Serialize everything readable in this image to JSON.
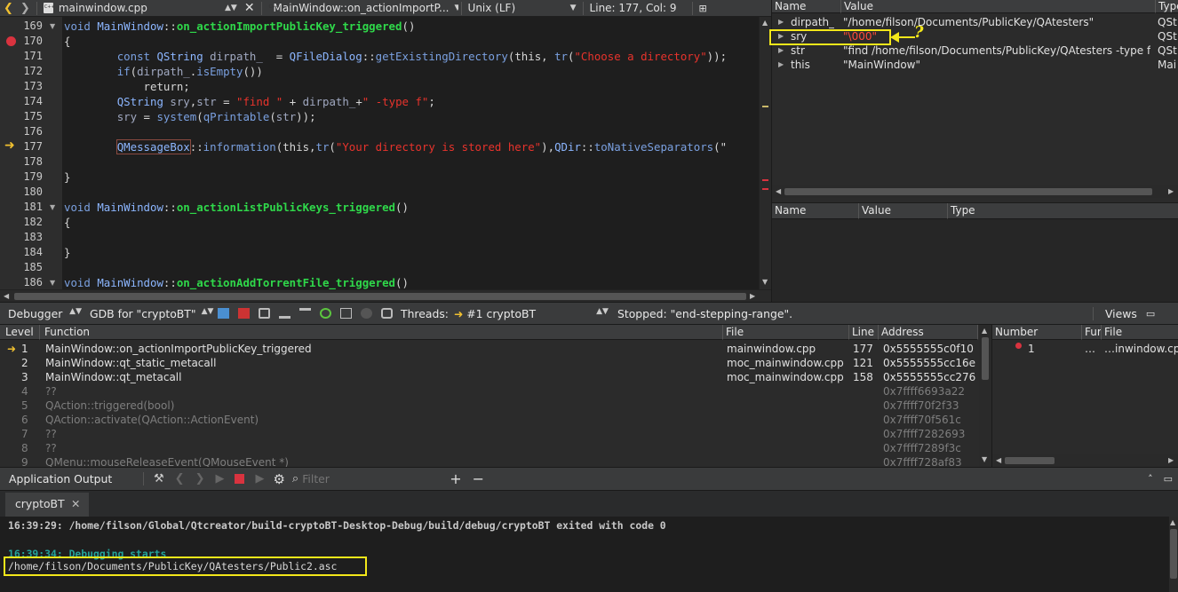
{
  "editor_toolbar": {
    "file_name": "mainwindow.cpp",
    "symbol": "MainWindow::on_actionImportP...",
    "line_ending": "Unix (LF)",
    "position": "Line: 177, Col: 9"
  },
  "code_lines": [
    {
      "n": "169",
      "fold": true
    },
    {
      "n": "170",
      "bp": true
    },
    {
      "n": "171"
    },
    {
      "n": "172"
    },
    {
      "n": "173"
    },
    {
      "n": "174"
    },
    {
      "n": "175"
    },
    {
      "n": "176"
    },
    {
      "n": "177",
      "current": true
    },
    {
      "n": "178"
    },
    {
      "n": "179"
    },
    {
      "n": "180"
    },
    {
      "n": "181",
      "fold": true
    },
    {
      "n": "182"
    },
    {
      "n": "183"
    },
    {
      "n": "184"
    },
    {
      "n": "185"
    },
    {
      "n": "186",
      "fold": true
    }
  ],
  "code": {
    "l169": [
      "void ",
      "MainWindow",
      "::",
      "on_actionImportPublicKey_triggered",
      "()"
    ],
    "l170": "{",
    "l171": [
      "const ",
      "QString ",
      "dirpath_ ",
      " = ",
      "QFileDialog",
      "::",
      "getExistingDirectory",
      "(this, ",
      "tr",
      "(",
      "\"Choose a directory\"",
      "));"
    ],
    "l172": [
      "if",
      "(",
      "dirpath_",
      ".",
      "isEmpty",
      "())"
    ],
    "l173": "return;",
    "l174": [
      "QString ",
      "sry",
      ",",
      "str",
      " = ",
      "\"find \"",
      " + ",
      "dirpath_",
      "+",
      "\" -type f\"",
      ";"
    ],
    "l175": [
      "sry",
      " = ",
      "system",
      "(",
      "qPrintable",
      "(",
      "str",
      "));"
    ],
    "l177": [
      "QMessageBox",
      "::",
      "information",
      "(this,",
      "tr",
      "(",
      "\"Your directory is stored here\"",
      "),",
      "QDir",
      "::",
      "toNativeSeparators",
      "(\""
    ],
    "l179": "}",
    "l181": [
      "void ",
      "MainWindow",
      "::",
      "on_actionListPublicKeys_triggered",
      "()"
    ],
    "l182": "{",
    "l184": "}",
    "l186": [
      "void ",
      "MainWindow",
      "::",
      "on_actionAddTorrentFile_triggered",
      "()"
    ]
  },
  "locals": {
    "headers": [
      "Name",
      "Value",
      "Type"
    ],
    "rows": [
      {
        "name": "dirpath_",
        "value": "\"/home/filson/Documents/PublicKey/QAtesters\"",
        "type": "QSt"
      },
      {
        "name": "sry",
        "value": "\"\\000\"",
        "type": "QSt"
      },
      {
        "name": "str",
        "value": "\"find /home/filson/Documents/PublicKey/QAtesters -type f\"",
        "type": "QSt"
      },
      {
        "name": "this",
        "value": "\"MainWindow\"",
        "type": "Mai"
      }
    ],
    "annotation": "?"
  },
  "watch": {
    "headers": [
      "Name",
      "Value",
      "Type"
    ]
  },
  "debugger_bar": {
    "mode": "Debugger",
    "engine": "GDB for \"cryptoBT\"",
    "threads_label": "Threads:",
    "thread": "#1 cryptoBT",
    "status": "Stopped: \"end-stepping-range\".",
    "views": "Views"
  },
  "stack": {
    "headers": [
      "Level",
      "Function",
      "File",
      "Line",
      "Address"
    ],
    "rows": [
      {
        "level": "1",
        "function": "MainWindow::on_actionImportPublicKey_triggered",
        "file": "mainwindow.cpp",
        "line": "177",
        "address": "0x5555555c0f10",
        "current": true
      },
      {
        "level": "2",
        "function": "MainWindow::qt_static_metacall",
        "file": "moc_mainwindow.cpp",
        "line": "121",
        "address": "0x5555555cc16e"
      },
      {
        "level": "3",
        "function": "MainWindow::qt_metacall",
        "file": "moc_mainwindow.cpp",
        "line": "158",
        "address": "0x5555555cc276"
      },
      {
        "level": "4",
        "function": "??",
        "file": "",
        "line": "",
        "address": "0x7ffff6693a22",
        "dim": true
      },
      {
        "level": "5",
        "function": "QAction::triggered(bool)",
        "file": "",
        "line": "",
        "address": "0x7ffff70f2f33",
        "dim": true
      },
      {
        "level": "6",
        "function": "QAction::activate(QAction::ActionEvent)",
        "file": "",
        "line": "",
        "address": "0x7ffff70f561c",
        "dim": true
      },
      {
        "level": "7",
        "function": "??",
        "file": "",
        "line": "",
        "address": "0x7ffff7282693",
        "dim": true
      },
      {
        "level": "8",
        "function": "??",
        "file": "",
        "line": "",
        "address": "0x7ffff7289f3c",
        "dim": true
      },
      {
        "level": "9",
        "function": "QMenu::mouseReleaseEvent(QMouseEvent *)",
        "file": "",
        "line": "",
        "address": "0x7ffff728af83",
        "dim": true
      }
    ]
  },
  "breakpoints": {
    "headers": [
      "Number",
      "Fur",
      "File"
    ],
    "rows": [
      {
        "number": "1",
        "func": "…",
        "file": "…inwindow.cpp"
      }
    ]
  },
  "output": {
    "title": "Application Output",
    "filter_placeholder": "Filter",
    "tab": "cryptoBT",
    "lines": [
      {
        "text": "16:39:29: /home/filson/Global/Qtcreator/build-cryptoBT-Desktop-Debug/build/debug/cryptoBT exited with code 0",
        "color": "#c8c8c8"
      },
      {
        "text": "16:39:34: Debugging starts",
        "color": "#23a39a"
      },
      {
        "text": "/home/filson/Documents/PublicKey/QAtesters/Public2.asc",
        "color": "#d8d8d8"
      }
    ]
  },
  "colors": {
    "highlight": "#f3e71a",
    "breakpoint": "#d9333f",
    "current_arrow": "#f0c030"
  }
}
